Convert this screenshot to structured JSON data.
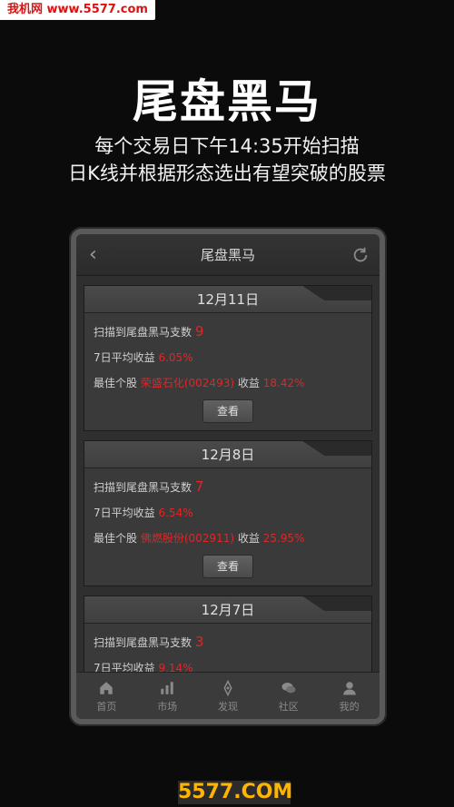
{
  "watermark_top": "我机网 www.5577.com",
  "hero": {
    "title": "尾盘黑马",
    "subtitle_line1": "每个交易日下午14:35开始扫描",
    "subtitle_line2": "日K线并根据形态选出有望突破的股票"
  },
  "app": {
    "header_title": "尾盘黑马",
    "cards": [
      {
        "date": "12月11日",
        "scan_label": "扫描到尾盘黑马支数",
        "scan_count": "9",
        "avg_label": "7日平均收益",
        "avg_value": "6.05%",
        "best_label": "最佳个股",
        "best_stock": "荣盛石化(002493)",
        "return_label": "收益",
        "return_value": "18.42%",
        "button": "查看"
      },
      {
        "date": "12月8日",
        "scan_label": "扫描到尾盘黑马支数",
        "scan_count": "7",
        "avg_label": "7日平均收益",
        "avg_value": "6.54%",
        "best_label": "最佳个股",
        "best_stock": "佛燃股份(002911)",
        "return_label": "收益",
        "return_value": "25.95%",
        "button": "查看"
      },
      {
        "date": "12月7日",
        "scan_label": "扫描到尾盘黑马支数",
        "scan_count": "3",
        "avg_label": "7日平均收益",
        "avg_value": "9.14%"
      }
    ],
    "tabs": [
      {
        "label": "首页",
        "icon": "home-icon"
      },
      {
        "label": "市场",
        "icon": "bar-chart-icon"
      },
      {
        "label": "发现",
        "icon": "compass-icon"
      },
      {
        "label": "社区",
        "icon": "chat-bubbles-icon"
      },
      {
        "label": "我的",
        "icon": "user-icon"
      }
    ]
  },
  "watermark_bottom": "5577.COM",
  "colors": {
    "accent_red": "#e22525",
    "background": "#0b0b0b",
    "panel": "#3a3a3a"
  }
}
